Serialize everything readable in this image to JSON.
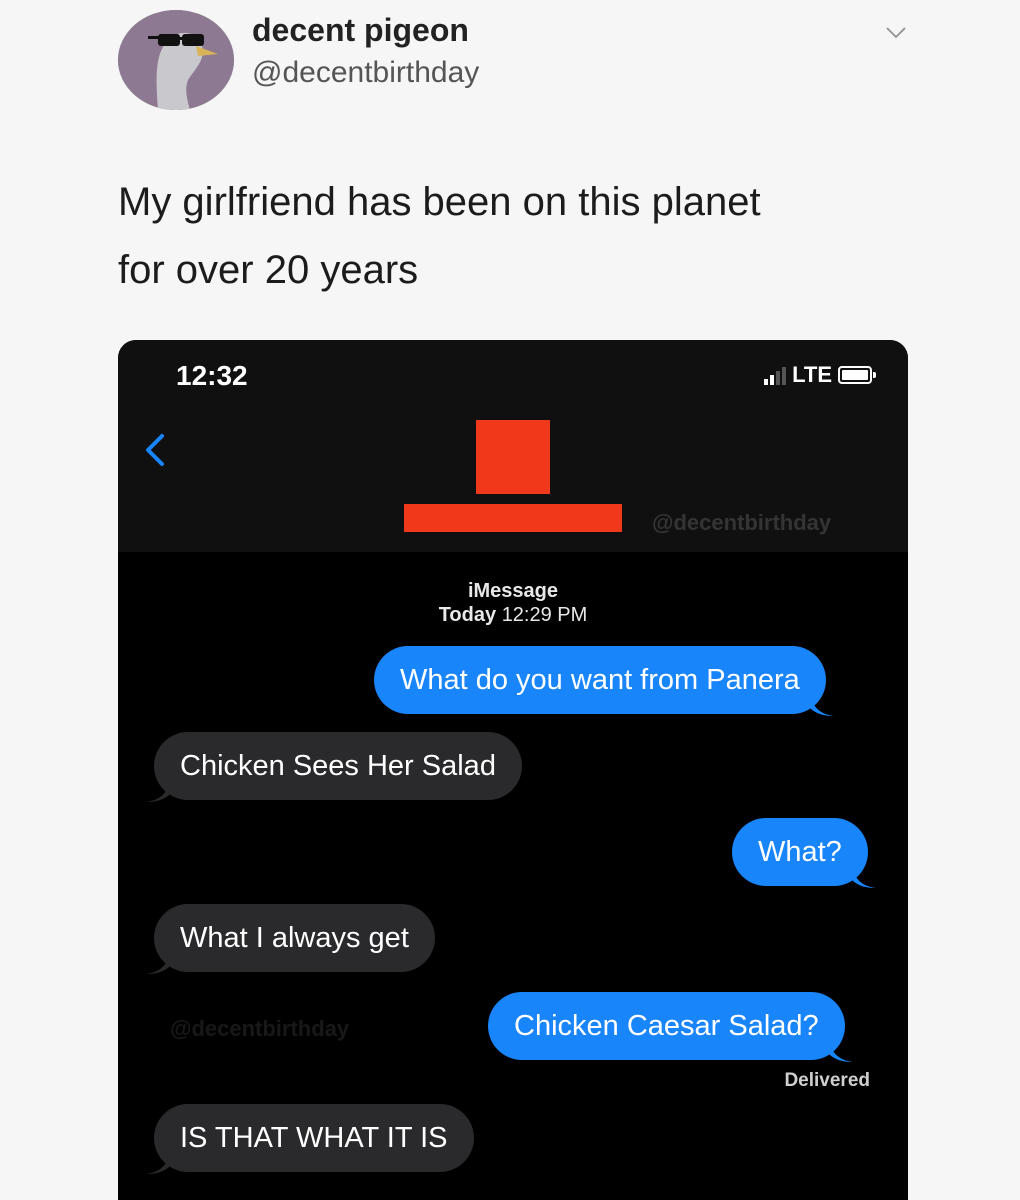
{
  "tweet": {
    "author_name": "decent pigeon",
    "author_handle": "@decentbirthday",
    "text_line1": "My girlfriend has been on this planet",
    "text_line2": "for over 20 years",
    "menu_icon": "chevron-down-icon"
  },
  "phone": {
    "status_time": "12:32",
    "network": "LTE",
    "watermark": "@decentbirthday",
    "service_label": "iMessage",
    "service_day": "Today",
    "service_time": "12:29 PM",
    "delivered_label": "Delivered",
    "colors": {
      "sent_bubble": "#1985fb",
      "received_bubble": "#2a2a2c",
      "redaction": "#f0391b"
    }
  },
  "messages": [
    {
      "direction": "sent",
      "text": "What do you want from Panera"
    },
    {
      "direction": "received",
      "text": "Chicken Sees Her Salad"
    },
    {
      "direction": "sent",
      "text": "What?"
    },
    {
      "direction": "received",
      "text": "What I always get"
    },
    {
      "direction": "sent",
      "text": "Chicken Caesar Salad?"
    },
    {
      "direction": "received",
      "text": "IS THAT WHAT IT IS"
    }
  ]
}
